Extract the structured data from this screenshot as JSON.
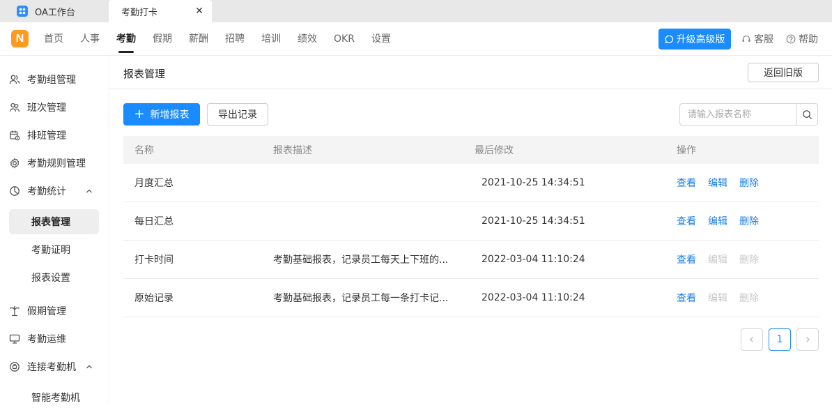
{
  "tabs": {
    "oa": "OA工作台",
    "active": "考勤打卡",
    "close_glyph": "✕"
  },
  "logo": "N",
  "nav": {
    "items": [
      "首页",
      "人事",
      "考勤",
      "假期",
      "薪酬",
      "招聘",
      "培训",
      "绩效",
      "OKR",
      "设置"
    ],
    "active_index": 2,
    "upgrade": "升级高级版",
    "service": "客服",
    "help": "帮助"
  },
  "sidebar": {
    "items": [
      {
        "label": "考勤组管理",
        "icon": "user-group-icon"
      },
      {
        "label": "班次管理",
        "icon": "users-icon"
      },
      {
        "label": "排班管理",
        "icon": "calendar-icon"
      },
      {
        "label": "考勤规则管理",
        "icon": "gear-icon"
      },
      {
        "label": "考勤统计",
        "icon": "pie-chart-icon"
      },
      {
        "label": "假期管理",
        "icon": "palm-tree-icon"
      },
      {
        "label": "考勤运维",
        "icon": "monitor-icon"
      },
      {
        "label": "连接考勤机",
        "icon": "device-icon"
      }
    ],
    "stats_sub": [
      "报表管理",
      "考勤证明",
      "报表设置"
    ],
    "device_sub": [
      "智能考勤机"
    ]
  },
  "main": {
    "title": "报表管理",
    "back": "返回旧版",
    "add": "新增报表",
    "add_glyph": "+",
    "export": "导出记录",
    "search_placeholder": "请输入报表名称",
    "columns": [
      "名称",
      "报表描述",
      "最后修改",
      "操作"
    ],
    "rows": [
      {
        "name": "月度汇总",
        "desc": "",
        "time": "2021-10-25 14:34:51",
        "editable": true
      },
      {
        "name": "每日汇总",
        "desc": "",
        "time": "2021-10-25 14:34:51",
        "editable": true
      },
      {
        "name": "打卡时间",
        "desc": "考勤基础报表，记录员工每天上下班的...",
        "time": "2022-03-04 11:10:24",
        "editable": false
      },
      {
        "name": "原始记录",
        "desc": "考勤基础报表，记录员工每一条打卡记...",
        "time": "2022-03-04 11:10:24",
        "editable": false
      }
    ],
    "ops": {
      "view": "查看",
      "edit": "编辑",
      "delete": "删除"
    },
    "page": "1"
  },
  "colors": {
    "primary": "#1a8cff",
    "logo": "#ff9a1f",
    "link": "#1a7fe8",
    "disabled": "#c8c8c8"
  }
}
